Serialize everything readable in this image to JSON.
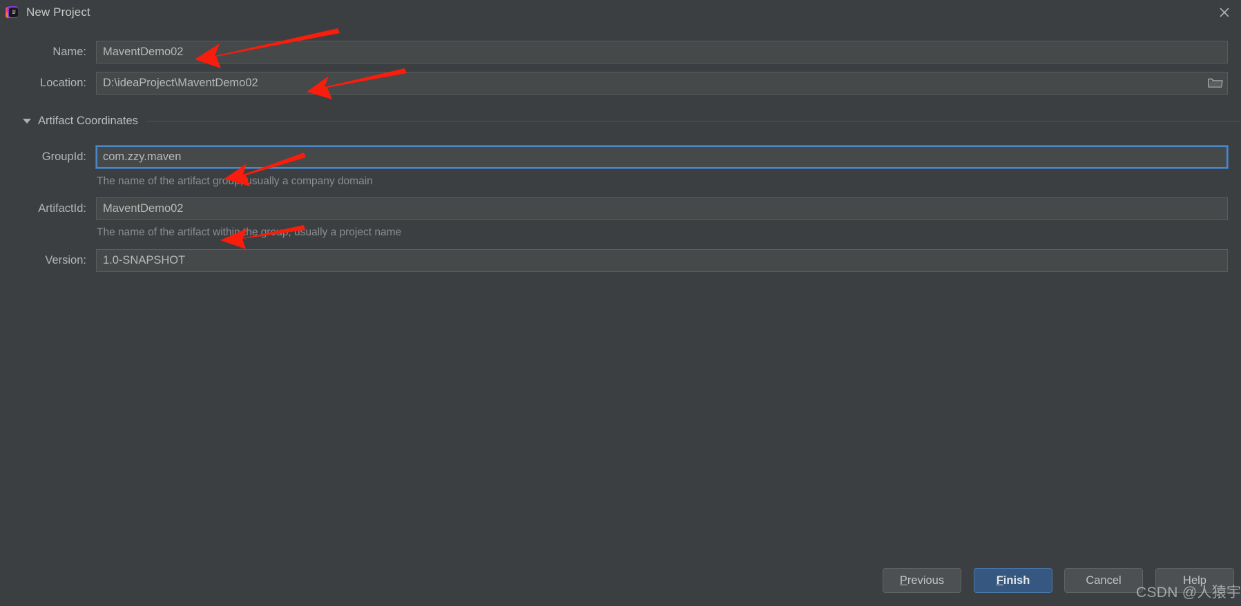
{
  "window": {
    "title": "New Project",
    "app_icon": "intellij-idea-icon",
    "close_icon": "close-icon"
  },
  "form": {
    "name": {
      "label": "Name:",
      "value": "MaventDemo02"
    },
    "location": {
      "label": "Location:",
      "value": "D:\\ideaProject\\MaventDemo02",
      "browse_icon": "folder-icon"
    },
    "section": {
      "label": "Artifact Coordinates",
      "expanded": true,
      "toggle_icon": "chevron-down-icon"
    },
    "group_id": {
      "label": "GroupId:",
      "value": "com.zzy.maven",
      "hint": "The name of the artifact group, usually a company domain",
      "focused": true
    },
    "artifact_id": {
      "label": "ArtifactId:",
      "value": "MaventDemo02",
      "hint": "The name of the artifact within the group, usually a project name"
    },
    "version": {
      "label": "Version:",
      "value": "1.0-SNAPSHOT"
    }
  },
  "footer": {
    "previous": {
      "label": "Previous",
      "mnemonic": "P",
      "rest": "revious"
    },
    "finish": {
      "label": "Finish",
      "mnemonic": "F",
      "rest": "inish"
    },
    "cancel": {
      "label": "Cancel"
    },
    "help": {
      "label": "Help"
    }
  },
  "watermark": {
    "text": "CSDN @人猿宇宙"
  },
  "colors": {
    "dialog_background": "#3c3f41",
    "field_background": "#45494a",
    "field_border": "#5a5d5e",
    "focus_border": "#4a88c7",
    "primary_button": "#365880",
    "text": "#b5b5b5",
    "hint_text": "#8b8e8f",
    "annotation_arrow": "#f81d0c"
  }
}
